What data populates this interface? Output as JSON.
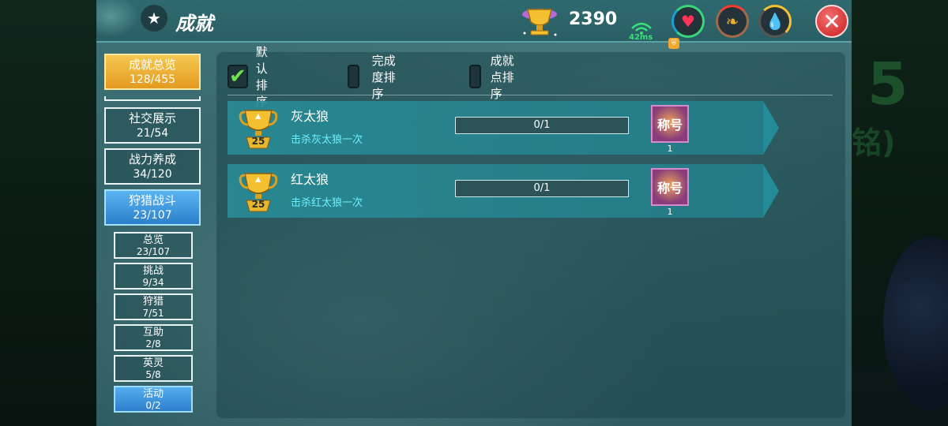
{
  "header": {
    "title": "成就",
    "currency_value": "2390",
    "ping": "42ms"
  },
  "nav": {
    "overview": {
      "label": "成就总览",
      "count": "128/455"
    },
    "categories": [
      {
        "label": "社交展示",
        "count": "21/54"
      },
      {
        "label": "战力养成",
        "count": "34/120"
      },
      {
        "label": "狩猎战斗",
        "count": "23/107"
      }
    ],
    "sub_items": [
      {
        "label": "总览",
        "count": "23/107"
      },
      {
        "label": "挑战",
        "count": "9/34"
      },
      {
        "label": "狩猎",
        "count": "7/51"
      },
      {
        "label": "互助",
        "count": "2/8"
      },
      {
        "label": "英灵",
        "count": "5/8"
      },
      {
        "label": "活动",
        "count": "0/2"
      }
    ]
  },
  "sort": {
    "options": [
      {
        "label": "默认排序",
        "checked": true
      },
      {
        "label": "完成度排序",
        "checked": false
      },
      {
        "label": "成就点排序",
        "checked": false
      }
    ]
  },
  "achievements": [
    {
      "name": "灰太狼",
      "desc": "击杀灰太狼一次",
      "points": "25",
      "progress": "0/1",
      "reward_label": "称号",
      "reward_qty": "1"
    },
    {
      "name": "红太狼",
      "desc": "击杀红太狼一次",
      "points": "25",
      "progress": "0/1",
      "reward_label": "称号",
      "reward_qty": "1"
    }
  ],
  "background_text": {
    "big": "5",
    "small": "铭)"
  },
  "colors": {
    "panel": "#37676b",
    "gold_tab": "#e39a20",
    "active_tab": "#2c80cc",
    "desc_text": "#6ff0ff",
    "checkmark": "#6fe04e",
    "close": "#d43535"
  }
}
